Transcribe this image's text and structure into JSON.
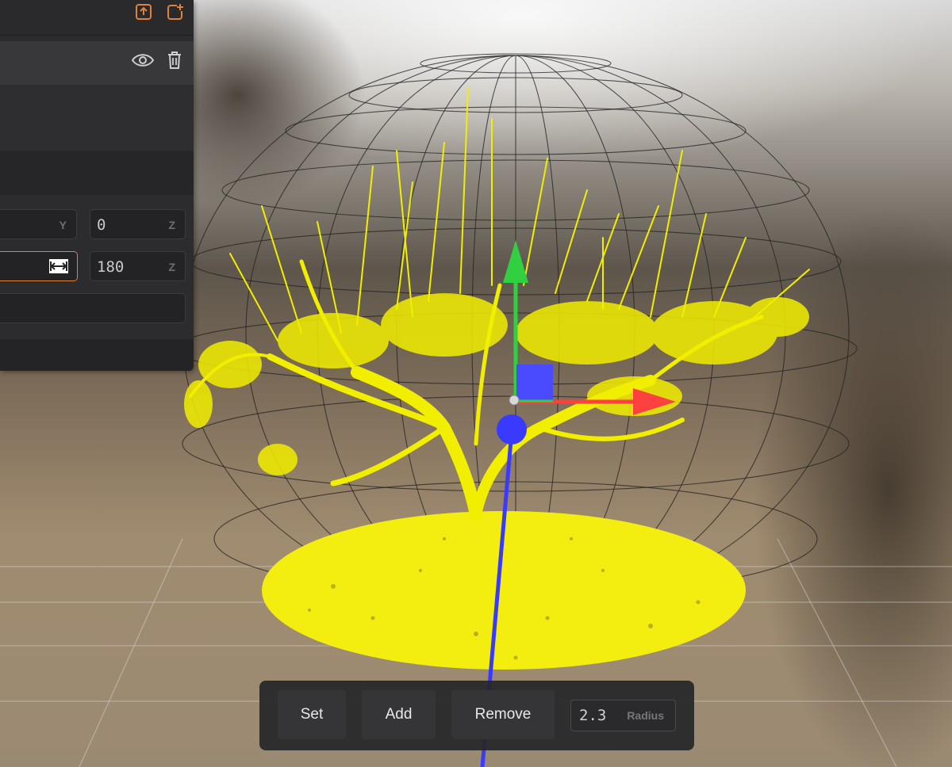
{
  "scene": {
    "description_name": "3d-viewport",
    "colors": {
      "selection": "#ffff00",
      "gizmo_x": "#ff4040",
      "gizmo_y": "#30d040",
      "gizmo_z": "#3a3aff",
      "accent": "#e0823a"
    }
  },
  "panel": {
    "header_icons": [
      "export-icon",
      "add-icon"
    ],
    "layer_icons": [
      "eye-icon",
      "trash-icon"
    ],
    "position": {
      "y_value": "",
      "y_axis": "Y",
      "z_value": "0",
      "z_axis": "Z"
    },
    "rotation": {
      "z_value": "180",
      "z_axis": "Z",
      "active_icon": "resize-horizontal-icon"
    }
  },
  "toolbar": {
    "set_label": "Set",
    "add_label": "Add",
    "remove_label": "Remove",
    "radius_value": "2.3",
    "radius_label": "Radius"
  }
}
